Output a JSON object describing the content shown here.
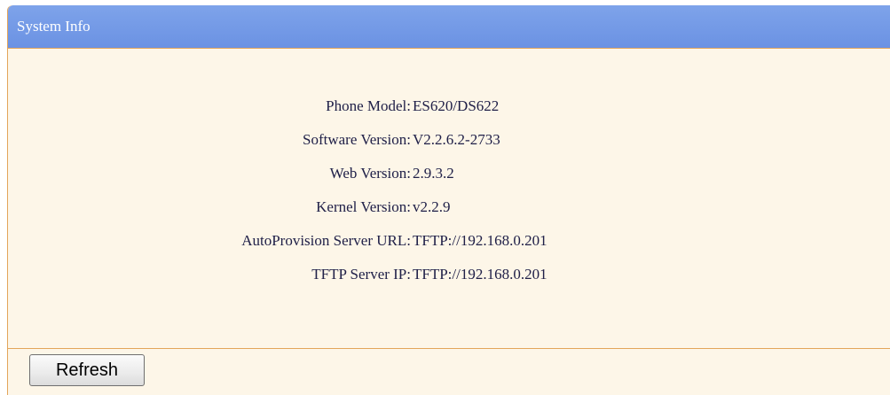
{
  "panel": {
    "title": "System Info"
  },
  "info": [
    {
      "label": "Phone Model:",
      "value": "ES620/DS622"
    },
    {
      "label": "Software Version:",
      "value": "V2.2.6.2-2733"
    },
    {
      "label": "Web Version:",
      "value": "2.9.3.2"
    },
    {
      "label": "Kernel Version:",
      "value": "v2.2.9"
    },
    {
      "label": "AutoProvision Server URL:",
      "value": "TFTP://192.168.0.201"
    },
    {
      "label": "TFTP Server IP:",
      "value": "TFTP://192.168.0.201"
    }
  ],
  "actions": {
    "refresh_label": "Refresh"
  },
  "colors": {
    "header": "#7ea3ea",
    "body_background": "#fdf6e8",
    "border": "#e3a55a",
    "text": "#202048"
  }
}
